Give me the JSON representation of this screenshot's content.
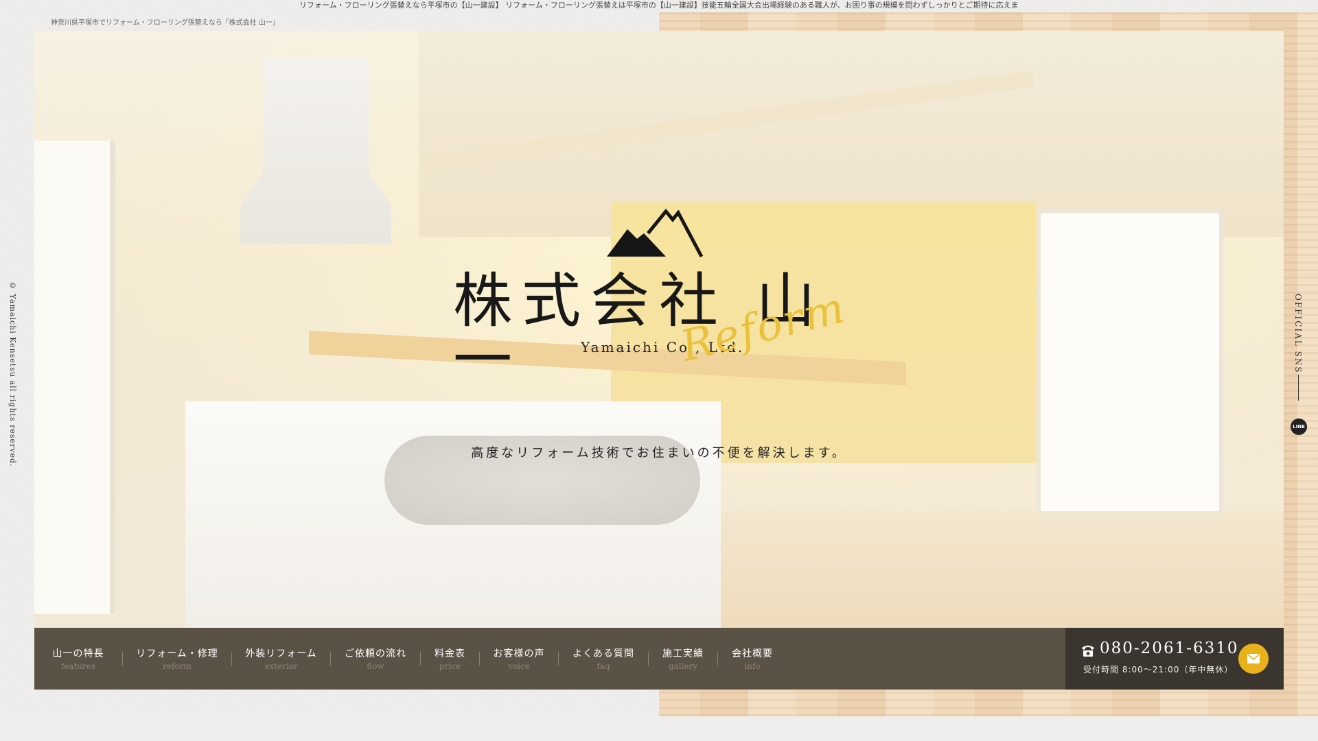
{
  "ticker": "リフォーム・フローリング張替えなら平塚市の【山一建設】 リフォーム・フローリング張替えは平塚市の【山一建設】技能五輪全国大会出場経験のある職人が、お困り事の規模を問わずしっかりとご期待に応えま",
  "subtitle": "神奈川県平塚市でリフォーム・フローリング張替えなら「株式会社 山一」",
  "logo": {
    "name": "株式会社 山一",
    "english": "Yamaichi Co., Ltd.",
    "script": "Reform",
    "accent_color": "#e9c13b"
  },
  "tagline": "高度なリフォーム技術でお住まいの不便を解決します。",
  "copyright": "© Yamaichi Kensetsu all rights reserved.",
  "sns": {
    "heading": "OFFICIAL SNS",
    "line_label": "LINE"
  },
  "nav": [
    {
      "jp": "山一の特長",
      "en": "features"
    },
    {
      "jp": "リフォーム・修理",
      "en": "reform"
    },
    {
      "jp": "外装リフォーム",
      "en": "exterior"
    },
    {
      "jp": "ご依頼の流れ",
      "en": "flow"
    },
    {
      "jp": "料金表",
      "en": "price"
    },
    {
      "jp": "お客様の声",
      "en": "voice"
    },
    {
      "jp": "よくある質問",
      "en": "faq"
    },
    {
      "jp": "施工実績",
      "en": "gallery"
    },
    {
      "jp": "会社概要",
      "en": "info"
    }
  ],
  "contact": {
    "phone": "080-2061-6310",
    "hours": "受付時間 8:00～21:00（年中無休）",
    "phone_icon": "phone-icon",
    "mail_icon": "mail-icon",
    "mail_button_color": "#e8b21a"
  }
}
